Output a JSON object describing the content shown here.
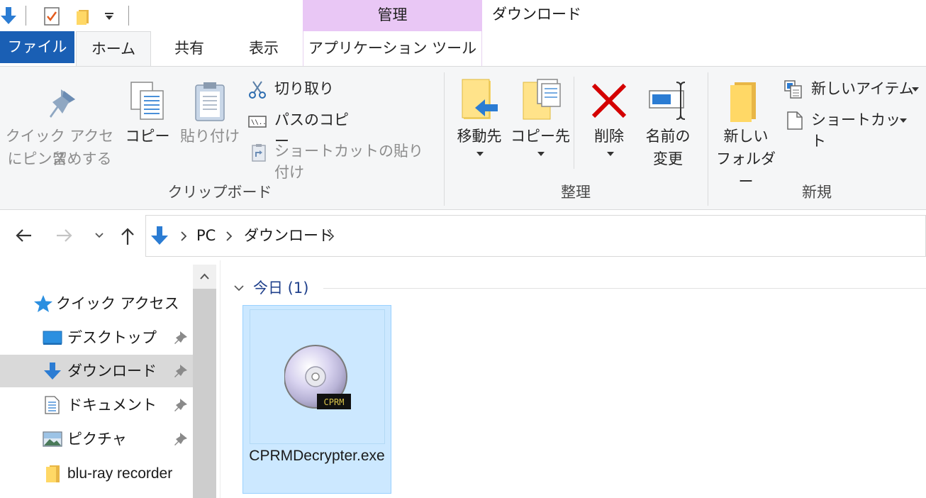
{
  "window": {
    "title": "ダウンロード",
    "contextual_header": "管理"
  },
  "quick_access_toolbar": {
    "icons": [
      "download-arrow-icon",
      "properties-icon",
      "new-folder-icon",
      "customize-dropdown-icon"
    ]
  },
  "tabs": [
    {
      "label": "ファイル",
      "active": false
    },
    {
      "label": "ホーム",
      "active": true
    },
    {
      "label": "共有",
      "active": false
    },
    {
      "label": "表示",
      "active": false
    },
    {
      "label": "アプリケーション ツール",
      "active": false
    }
  ],
  "ribbon": {
    "clipboard": {
      "pin_line1": "クイック アクセス",
      "pin_line2": "にピン留めする",
      "copy": "コピー",
      "paste": "貼り付け",
      "cut": "切り取り",
      "copy_path": "パスのコピー",
      "paste_shortcut": "ショートカットの貼り付け",
      "group_label": "クリップボード"
    },
    "organize": {
      "move_to": "移動先",
      "copy_to": "コピー先",
      "delete": "削除",
      "rename_line1": "名前の",
      "rename_line2": "変更",
      "group_label": "整理"
    },
    "new": {
      "new_folder_line1": "新しい",
      "new_folder_line2": "フォルダー",
      "new_item": "新しいアイテム",
      "easy_access": "ショートカット",
      "group_label": "新規"
    }
  },
  "address": {
    "crumbs": [
      "PC",
      "ダウンロード"
    ]
  },
  "nav_pane": {
    "quick_access": "クイック アクセス",
    "items": [
      {
        "label": "デスクトップ",
        "pinned": true,
        "selected": false
      },
      {
        "label": "ダウンロード",
        "pinned": true,
        "selected": true
      },
      {
        "label": "ドキュメント",
        "pinned": true,
        "selected": false
      },
      {
        "label": "ピクチャ",
        "pinned": true,
        "selected": false
      },
      {
        "label": "blu-ray recorder",
        "pinned": false,
        "selected": false
      }
    ]
  },
  "content": {
    "group_header": "今日 (1)",
    "files": [
      {
        "name": "CPRMDecrypter.exe",
        "selected": true,
        "badge": "CPRM"
      }
    ]
  },
  "colors": {
    "file_tab": "#1a5fb4",
    "contextual": "#e9c7f5",
    "selection": "#cce8ff",
    "group_header": "#1e3f8b",
    "delete_red": "#d40000"
  }
}
